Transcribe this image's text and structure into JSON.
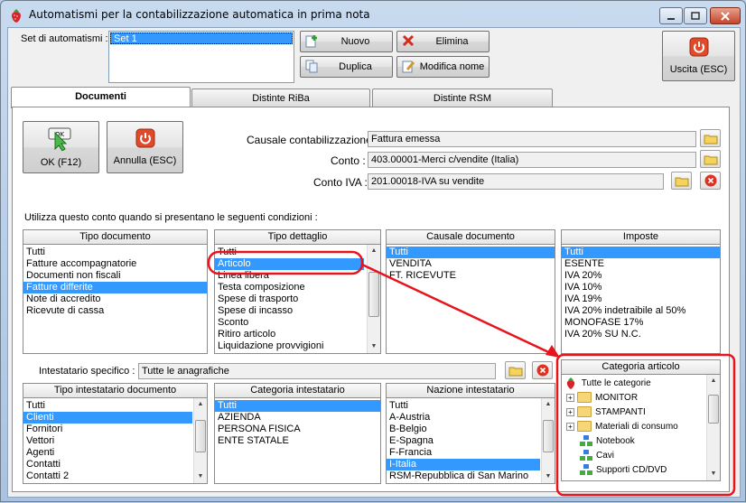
{
  "window": {
    "title": "Automatismi per la contabilizzazione automatica in prima nota"
  },
  "top": {
    "set_label": "Set di automatismi :",
    "sets": [
      "Set 1"
    ],
    "btn_new": "Nuovo",
    "btn_delete": "Elimina",
    "btn_duplicate": "Duplica",
    "btn_rename": "Modifica nome",
    "btn_exit": "Uscita (ESC)"
  },
  "tabs": [
    {
      "label": "Documenti"
    },
    {
      "label": "Distinte RiBa"
    },
    {
      "label": "Distinte RSM"
    }
  ],
  "actions": {
    "ok": "OK (F12)",
    "cancel": "Annulla (ESC)",
    "ok_icon_text": "OK"
  },
  "fields": {
    "causale_label": "Causale contabilizzazione :",
    "causale_value": "Fattura emessa",
    "conto_label": "Conto :",
    "conto_value": "403.00001-Merci c/vendite (Italia)",
    "conto_iva_label": "Conto IVA :",
    "conto_iva_value": "201.00018-IVA su vendite"
  },
  "conditions_label": "Utilizza questo conto quando si presentano le seguenti condizioni :",
  "tipo_documento": {
    "title": "Tipo documento",
    "items": [
      "Tutti",
      "Fatture accompagnatorie",
      "Documenti non fiscali",
      "Fatture differite",
      "Note di accredito",
      "Ricevute di cassa"
    ],
    "selected": 3
  },
  "tipo_dettaglio": {
    "title": "Tipo dettaglio",
    "items": [
      "Tutti",
      "Articolo",
      "Linea libera",
      "Testa composizione",
      "Spese di trasporto",
      "Spese di incasso",
      "Sconto",
      "Ritiro articolo",
      "Liquidazione provvigioni"
    ],
    "selected": 1
  },
  "causale_documento": {
    "title": "Causale documento",
    "items": [
      "Tutti",
      "VENDITA",
      "FT. RICEVUTE"
    ],
    "selected": 0
  },
  "imposte": {
    "title": "Imposte",
    "items": [
      "Tutti",
      "ESENTE",
      "IVA 20%",
      "IVA 10%",
      "IVA 19%",
      "IVA 20% indetraibile al 50%",
      "MONOFASE 17%",
      "IVA 20% SU N.C."
    ],
    "selected": 0
  },
  "intestatario": {
    "label": "Intestatario specifico :",
    "value": "Tutte le anagrafiche"
  },
  "tipo_intestatario": {
    "title": "Tipo intestatario documento",
    "items": [
      "Tutti",
      "Clienti",
      "Fornitori",
      "Vettori",
      "Agenti",
      "Contatti",
      "Contatti 2"
    ],
    "selected": 1
  },
  "categoria_intestatario": {
    "title": "Categoria intestatario",
    "items": [
      "Tutti",
      "AZIENDA",
      "PERSONA FISICA",
      "ENTE STATALE"
    ],
    "selected": 0
  },
  "nazione_intestatario": {
    "title": "Nazione intestatario",
    "items": [
      "Tutti",
      "A-Austria",
      "B-Belgio",
      "E-Spagna",
      "F-Francia",
      "I-Italia",
      "RSM-Repubblica di San Marino"
    ],
    "selected": 5
  },
  "categoria_articolo": {
    "title": "Categoria articolo",
    "root": "Tutte le categorie",
    "folders": [
      "MONITOR",
      "STAMPANTI",
      "Materiali di consumo"
    ],
    "leaves": [
      "Notebook",
      "Cavi",
      "Supporti CD/DVD"
    ]
  },
  "colors": {
    "selection": "#3399ff",
    "annotation": "#e8141c"
  }
}
